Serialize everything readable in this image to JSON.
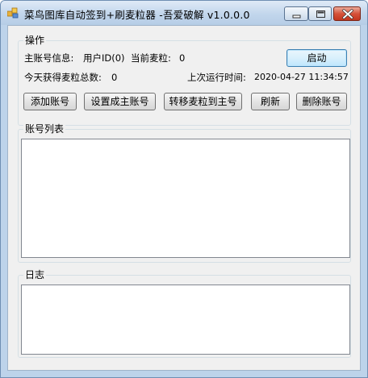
{
  "window": {
    "title": "菜鸟图库自动签到+刷麦粒器  -吾爱破解 v1.0.0.0"
  },
  "ops": {
    "group_label": "操作",
    "main_account_label": "主账号信息:",
    "user_id_text": "用户ID(0)",
    "current_label": "当前麦粒:",
    "current_value": "0",
    "start_button": "启动",
    "today_total_label": "今天获得麦粒总数:",
    "today_total_value": "0",
    "last_run_label": "上次运行时间:",
    "last_run_value": "2020-04-27 11:34:57"
  },
  "buttons": {
    "add_account": "添加账号",
    "set_main": "设置成主账号",
    "transfer": "转移麦粒到主号",
    "refresh": "刷新",
    "delete_account": "删除账号"
  },
  "accounts": {
    "group_label": "账号列表"
  },
  "log": {
    "group_label": "日志"
  }
}
